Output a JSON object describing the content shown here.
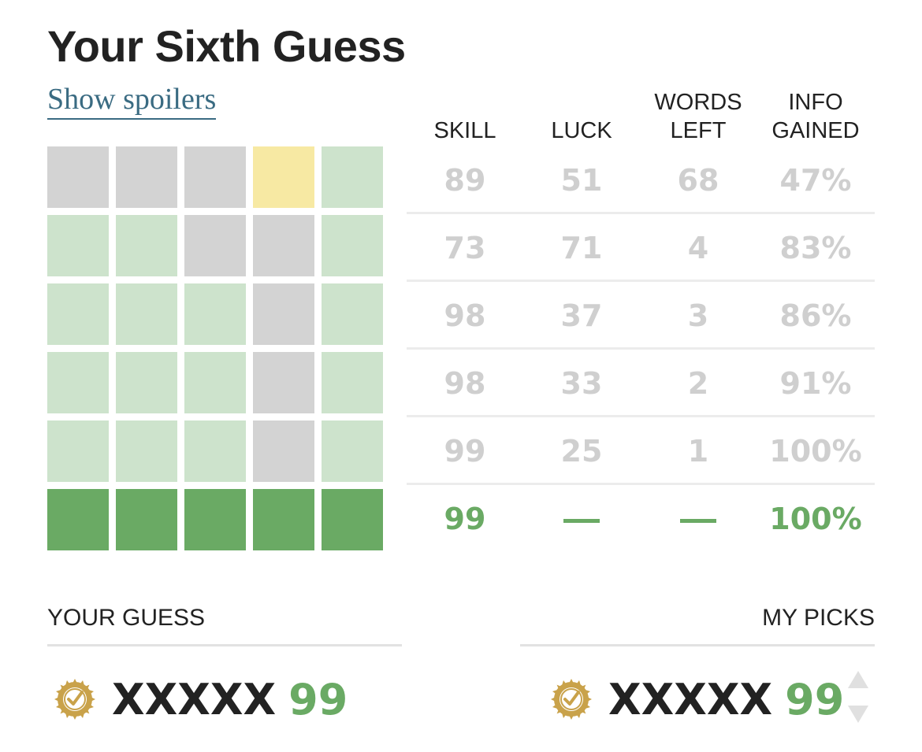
{
  "title": "Your Sixth Guess",
  "spoilers_link": "Show spoilers",
  "colors": {
    "gray": "#d3d3d3",
    "yellow": "#f7e9a3",
    "light_green": "#cde3cc",
    "green": "#6aaa64",
    "muted_text": "#cfcfcf",
    "link": "#3a6b82"
  },
  "grid": [
    [
      "gray",
      "gray",
      "gray",
      "yellow",
      "light_green"
    ],
    [
      "light_green",
      "light_green",
      "gray",
      "gray",
      "light_green"
    ],
    [
      "light_green",
      "light_green",
      "light_green",
      "gray",
      "light_green"
    ],
    [
      "light_green",
      "light_green",
      "light_green",
      "gray",
      "light_green"
    ],
    [
      "light_green",
      "light_green",
      "light_green",
      "gray",
      "light_green"
    ],
    [
      "green",
      "green",
      "green",
      "green",
      "green"
    ]
  ],
  "stats": {
    "headers": {
      "skill": "SKILL",
      "luck": "LUCK",
      "words_left_1": "WORDS",
      "words_left_2": "LEFT",
      "info_1": "INFO",
      "info_2": "GAINED"
    },
    "rows": [
      {
        "skill": "89",
        "luck": "51",
        "words": "68",
        "info": "47%"
      },
      {
        "skill": "73",
        "luck": "71",
        "words": "4",
        "info": "83%"
      },
      {
        "skill": "98",
        "luck": "37",
        "words": "3",
        "info": "86%"
      },
      {
        "skill": "98",
        "luck": "33",
        "words": "2",
        "info": "91%"
      },
      {
        "skill": "99",
        "luck": "25",
        "words": "1",
        "info": "100%"
      },
      {
        "skill": "99",
        "luck": "—",
        "words": "—",
        "info": "100%"
      }
    ]
  },
  "your_guess": {
    "label": "YOUR GUESS",
    "word": "XXXXX",
    "score": "99",
    "icon": "check-badge-icon"
  },
  "my_picks": {
    "label": "MY PICKS",
    "word": "XXXXX",
    "score": "99",
    "icon": "check-badge-icon"
  }
}
